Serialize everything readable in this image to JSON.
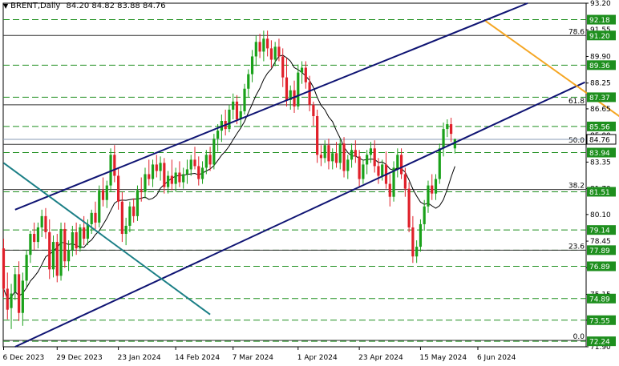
{
  "header": {
    "symbol": "BRENT,Daily",
    "ohlc": "84.20 84.82 83.88 84.76"
  },
  "colors": {
    "background": "#ffffff",
    "bull": "#1aa11a",
    "bear": "#e0202a",
    "channel": "#0f1473",
    "resistance": "#f5a623",
    "old_trend": "#1b7f86",
    "ma": "#000000",
    "grid": "#1e8f1e",
    "price_tag": "#1e8f1e"
  },
  "chart_data": {
    "type": "candlestick",
    "title": "BRENT,Daily",
    "ylim": [
      71.9,
      93.2
    ],
    "x_ticks": [
      {
        "i": 0,
        "label": "6 Dec 2023"
      },
      {
        "i": 14,
        "label": "29 Dec 2023"
      },
      {
        "i": 30,
        "label": "23 Jan 2024"
      },
      {
        "i": 45,
        "label": "14 Feb 2024"
      },
      {
        "i": 60,
        "label": "7 Mar 2024"
      },
      {
        "i": 77,
        "label": "1 Apr 2024"
      },
      {
        "i": 93,
        "label": "23 Apr 2024"
      },
      {
        "i": 109,
        "label": "15 May 2024"
      },
      {
        "i": 124,
        "label": "6 Jun 2024"
      }
    ],
    "y_ticks": [
      {
        "value": 93.2,
        "label": "93.20"
      },
      {
        "value": 91.55,
        "label": "91.55"
      },
      {
        "value": 89.9,
        "label": "89.90"
      },
      {
        "value": 88.25,
        "label": "88.25"
      },
      {
        "value": 86.65,
        "label": "86.65"
      },
      {
        "value": 85.0,
        "label": "85.00"
      },
      {
        "value": 83.35,
        "label": "83.35"
      },
      {
        "value": 81.7,
        "label": "81.70"
      },
      {
        "value": 80.1,
        "label": "80.10"
      },
      {
        "value": 78.45,
        "label": "78.45"
      },
      {
        "value": 76.8,
        "label": "76.80"
      },
      {
        "value": 75.15,
        "label": "75.15"
      },
      {
        "value": 73.55,
        "label": "73.55"
      },
      {
        "value": 71.9,
        "label": "71.90"
      }
    ],
    "levels": [
      {
        "value": 92.18,
        "label": "92.18"
      },
      {
        "value": 89.36,
        "label": "89.36"
      },
      {
        "value": 87.37,
        "label": "87.37"
      },
      {
        "value": 85.56,
        "label": "85.56"
      },
      {
        "value": 83.94,
        "label": "83.94"
      },
      {
        "value": 81.51,
        "label": "81.51"
      },
      {
        "value": 79.14,
        "label": "79.14"
      },
      {
        "value": 77.89,
        "label": "77.89"
      },
      {
        "value": 76.89,
        "label": "76.89"
      },
      {
        "value": 74.89,
        "label": "74.89"
      },
      {
        "value": 73.55,
        "label": "73.55"
      },
      {
        "value": 72.24,
        "label": "72.24"
      }
    ],
    "fib_levels": [
      {
        "value": 91.2,
        "label": "78.6",
        "price": "91.20"
      },
      {
        "value": 86.9,
        "label": "61.8",
        "price": ""
      },
      {
        "value": 84.45,
        "label": "50.0",
        "price": ""
      },
      {
        "value": 81.65,
        "label": "38.2",
        "price": ""
      },
      {
        "value": 77.89,
        "label": "23.6",
        "price": ""
      },
      {
        "value": 72.3,
        "label": "0.0",
        "price": ""
      }
    ],
    "current_price": {
      "value": 84.76,
      "label": "84.76"
    },
    "channel": {
      "upper": {
        "from": [
          3,
          80.4
        ],
        "to": [
          137,
          93.2
        ]
      },
      "lower": {
        "from": [
          3,
          71.9
        ],
        "to": [
          152,
          88.3
        ]
      }
    },
    "resistance_line": {
      "from": [
        126,
        92.1
      ],
      "to": [
        200,
        79.6
      ]
    },
    "old_trend_line": {
      "from": [
        0,
        83.3
      ],
      "to": [
        54,
        73.9
      ]
    },
    "candles": [
      [
        78.0,
        78.6,
        75.0,
        75.5
      ],
      [
        75.5,
        76.5,
        73.6,
        74.2
      ],
      [
        74.3,
        75.8,
        73.0,
        75.2
      ],
      [
        75.3,
        76.8,
        74.8,
        76.4
      ],
      [
        76.4,
        77.2,
        73.5,
        74.0
      ],
      [
        74.0,
        76.5,
        73.2,
        76.0
      ],
      [
        76.0,
        77.9,
        75.6,
        77.6
      ],
      [
        77.6,
        79.1,
        77.1,
        78.9
      ],
      [
        78.9,
        79.6,
        77.9,
        78.4
      ],
      [
        78.4,
        79.6,
        78.0,
        79.3
      ],
      [
        79.3,
        80.4,
        78.7,
        80.0
      ],
      [
        80.0,
        80.5,
        78.6,
        79.0
      ],
      [
        79.0,
        79.8,
        76.1,
        76.7
      ],
      [
        76.7,
        78.8,
        76.2,
        78.4
      ],
      [
        78.4,
        78.9,
        75.9,
        76.3
      ],
      [
        76.3,
        79.6,
        76.0,
        79.2
      ],
      [
        79.2,
        79.6,
        76.8,
        77.2
      ],
      [
        77.2,
        78.5,
        76.6,
        77.9
      ],
      [
        77.9,
        79.4,
        77.5,
        79.0
      ],
      [
        79.0,
        79.6,
        77.6,
        78.0
      ],
      [
        78.0,
        79.5,
        77.8,
        79.3
      ],
      [
        79.3,
        80.0,
        78.2,
        78.6
      ],
      [
        78.6,
        79.8,
        78.2,
        79.5
      ],
      [
        79.5,
        80.4,
        78.9,
        80.2
      ],
      [
        80.2,
        80.9,
        79.2,
        79.6
      ],
      [
        79.6,
        81.9,
        79.3,
        81.6
      ],
      [
        81.6,
        82.4,
        80.6,
        81.0
      ],
      [
        81.0,
        82.2,
        80.5,
        81.9
      ],
      [
        81.9,
        84.2,
        81.5,
        83.8
      ],
      [
        83.8,
        84.4,
        82.1,
        82.5
      ],
      [
        82.5,
        83.0,
        80.4,
        80.9
      ],
      [
        80.9,
        81.5,
        78.4,
        78.9
      ],
      [
        78.9,
        79.9,
        78.2,
        79.4
      ],
      [
        79.4,
        80.9,
        79.0,
        80.6
      ],
      [
        80.6,
        81.1,
        79.6,
        80.0
      ],
      [
        80.0,
        81.9,
        79.7,
        81.6
      ],
      [
        81.6,
        82.4,
        80.9,
        81.5
      ],
      [
        81.5,
        83.0,
        81.1,
        82.6
      ],
      [
        82.6,
        83.5,
        81.9,
        82.3
      ],
      [
        82.3,
        83.5,
        81.8,
        83.2
      ],
      [
        83.2,
        83.8,
        82.4,
        82.8
      ],
      [
        82.8,
        83.7,
        82.2,
        83.3
      ],
      [
        83.3,
        83.6,
        81.4,
        81.8
      ],
      [
        81.8,
        82.8,
        81.4,
        82.5
      ],
      [
        82.5,
        83.5,
        81.6,
        82.0
      ],
      [
        82.0,
        83.0,
        81.5,
        82.7
      ],
      [
        82.7,
        83.4,
        81.8,
        82.1
      ],
      [
        82.1,
        83.0,
        81.7,
        82.6
      ],
      [
        82.6,
        83.5,
        82.0,
        82.9
      ],
      [
        82.9,
        83.8,
        82.5,
        83.5
      ],
      [
        83.5,
        84.3,
        82.9,
        83.1
      ],
      [
        83.1,
        83.7,
        81.9,
        82.3
      ],
      [
        82.3,
        83.4,
        82.0,
        83.0
      ],
      [
        83.0,
        84.1,
        82.6,
        83.8
      ],
      [
        83.8,
        84.3,
        82.8,
        83.2
      ],
      [
        83.2,
        85.1,
        82.9,
        84.8
      ],
      [
        84.8,
        85.7,
        84.0,
        85.3
      ],
      [
        85.3,
        86.3,
        84.6,
        85.9
      ],
      [
        85.9,
        86.6,
        85.0,
        85.4
      ],
      [
        85.4,
        86.9,
        85.2,
        86.6
      ],
      [
        86.6,
        87.6,
        86.0,
        87.1
      ],
      [
        87.1,
        87.5,
        85.7,
        86.0
      ],
      [
        86.0,
        86.9,
        85.5,
        86.5
      ],
      [
        86.5,
        88.2,
        86.3,
        87.9
      ],
      [
        87.9,
        89.1,
        87.4,
        88.8
      ],
      [
        88.8,
        90.3,
        88.3,
        89.9
      ],
      [
        89.9,
        91.2,
        89.3,
        90.8
      ],
      [
        90.8,
        91.3,
        89.8,
        90.2
      ],
      [
        90.2,
        91.5,
        89.6,
        91.0
      ],
      [
        91.0,
        91.5,
        89.9,
        90.4
      ],
      [
        90.4,
        90.9,
        89.2,
        89.7
      ],
      [
        89.7,
        90.8,
        89.3,
        90.5
      ],
      [
        90.5,
        91.0,
        89.6,
        89.9
      ],
      [
        89.9,
        90.4,
        88.0,
        88.6
      ],
      [
        88.6,
        89.8,
        86.8,
        87.2
      ],
      [
        87.2,
        88.1,
        86.6,
        87.8
      ],
      [
        87.8,
        88.4,
        86.4,
        86.8
      ],
      [
        86.8,
        89.4,
        86.6,
        88.9
      ],
      [
        88.9,
        89.6,
        88.2,
        89.2
      ],
      [
        89.2,
        89.6,
        87.9,
        88.3
      ],
      [
        88.3,
        88.7,
        86.5,
        86.9
      ],
      [
        86.9,
        87.1,
        85.6,
        86.2
      ],
      [
        86.2,
        86.6,
        83.3,
        83.8
      ],
      [
        83.8,
        84.4,
        83.1,
        83.6
      ],
      [
        83.6,
        84.7,
        83.3,
        84.4
      ],
      [
        84.4,
        84.8,
        82.9,
        83.4
      ],
      [
        83.4,
        84.2,
        82.9,
        83.9
      ],
      [
        83.9,
        84.6,
        83.0,
        83.3
      ],
      [
        83.3,
        84.8,
        82.9,
        84.5
      ],
      [
        84.5,
        84.9,
        82.4,
        82.8
      ],
      [
        82.8,
        83.8,
        82.3,
        83.5
      ],
      [
        83.5,
        84.5,
        83.0,
        84.1
      ],
      [
        84.1,
        84.7,
        83.3,
        83.7
      ],
      [
        83.7,
        84.1,
        81.8,
        82.3
      ],
      [
        82.3,
        83.5,
        82.0,
        83.2
      ],
      [
        83.2,
        84.1,
        82.6,
        83.8
      ],
      [
        83.8,
        84.6,
        83.3,
        84.2
      ],
      [
        84.2,
        84.7,
        82.7,
        83.1
      ],
      [
        83.1,
        83.6,
        82.0,
        82.5
      ],
      [
        82.5,
        83.5,
        82.2,
        83.2
      ],
      [
        83.2,
        84.0,
        81.7,
        82.0
      ],
      [
        82.0,
        82.6,
        80.6,
        81.2
      ],
      [
        81.2,
        83.4,
        80.9,
        83.0
      ],
      [
        83.0,
        84.2,
        82.4,
        83.8
      ],
      [
        83.8,
        84.2,
        82.3,
        82.6
      ],
      [
        82.6,
        83.0,
        81.2,
        81.7
      ],
      [
        81.7,
        82.1,
        79.0,
        79.3
      ],
      [
        79.3,
        80.0,
        77.1,
        77.5
      ],
      [
        77.5,
        78.5,
        77.1,
        78.1
      ],
      [
        78.1,
        79.8,
        77.8,
        79.5
      ],
      [
        79.5,
        81.0,
        79.1,
        80.6
      ],
      [
        80.6,
        82.2,
        80.2,
        81.9
      ],
      [
        81.9,
        82.6,
        81.0,
        81.4
      ],
      [
        81.4,
        82.6,
        81.0,
        82.3
      ],
      [
        82.3,
        84.5,
        82.0,
        84.2
      ],
      [
        84.2,
        85.8,
        83.7,
        85.4
      ],
      [
        85.4,
        86.0,
        84.9,
        85.7
      ],
      [
        85.7,
        86.1,
        84.6,
        85.1
      ],
      [
        84.2,
        84.82,
        83.88,
        84.76
      ]
    ]
  }
}
